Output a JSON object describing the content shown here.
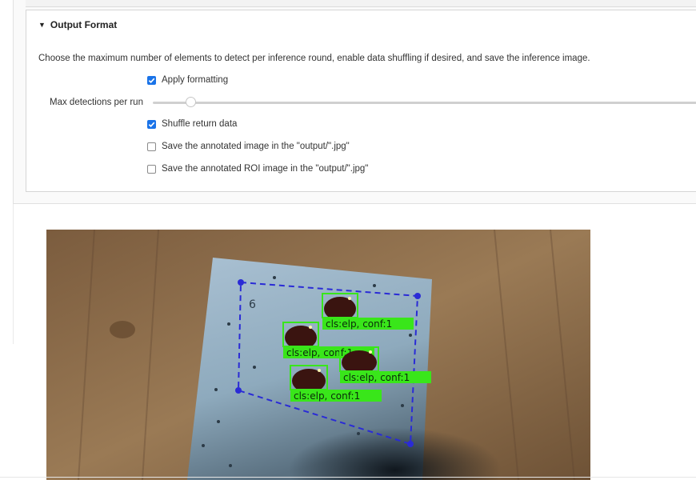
{
  "section": {
    "title": "Output Format",
    "description": "Choose the maximum number of elements to detect per inference round, enable data shuffling if desired, and save the inference image."
  },
  "options": {
    "apply_formatting": {
      "label": "Apply formatting",
      "checked": true
    },
    "shuffle": {
      "label": "Shuffle return data",
      "checked": true
    },
    "save_image": {
      "label": "Save the annotated image in the \"output/\".jpg\"",
      "checked": false
    },
    "save_roi": {
      "label": "Save the annotated ROI image in the \"output/\".jpg\"",
      "checked": false
    }
  },
  "slider": {
    "label": "Max detections per run",
    "value_fraction": 0.07
  },
  "inference_image": {
    "detection_label": "cls:elp, conf:1",
    "detection_count": 4,
    "colors": {
      "box": "#39e61a",
      "roi": "#2a2bd6",
      "wood": "#8a6a4a",
      "plate": "#9ab2c4"
    }
  }
}
